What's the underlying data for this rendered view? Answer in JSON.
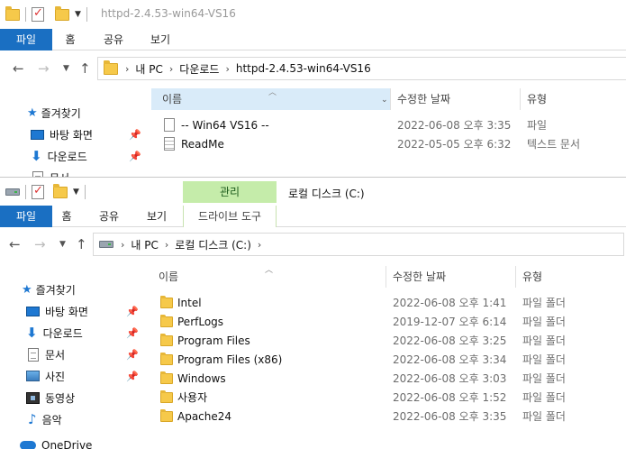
{
  "win1": {
    "title": "httpd-2.4.53-win64-VS16",
    "tabs": [
      "파일",
      "홈",
      "공유",
      "보기"
    ],
    "address": {
      "crumbs": [
        "내 PC",
        "다운로드",
        "httpd-2.4.53-win64-VS16"
      ]
    },
    "sidebar": {
      "items": [
        {
          "label": "즐겨찾기",
          "icon": "star-icon"
        },
        {
          "label": "바탕 화면",
          "icon": "desktop-icon",
          "pinned": true
        },
        {
          "label": "다운로드",
          "icon": "download-arrow-icon",
          "pinned": true
        },
        {
          "label": "문서",
          "icon": "document-icon",
          "pinned": true
        }
      ]
    },
    "columns": {
      "name": "이름",
      "date": "수정한 날짜",
      "type": "유형"
    },
    "files": [
      {
        "name": "-- Win64 VS16  --",
        "date": "2022-06-08 오후 3:35",
        "type": "파일",
        "icon": "blank-file-icon"
      },
      {
        "name": "ReadMe",
        "date": "2022-05-05 오후 6:32",
        "type": "텍스트 문서",
        "icon": "text-file-icon"
      }
    ]
  },
  "win2": {
    "tabs": [
      "파일",
      "홈",
      "공유",
      "보기"
    ],
    "context_tab_header": "관리",
    "context_tab": "드라이브 도구",
    "context_title": "로컬 디스크 (C:)",
    "address": {
      "crumbs": [
        "내 PC",
        "로컬 디스크 (C:)"
      ]
    },
    "sidebar": {
      "items": [
        {
          "label": "즐겨찾기",
          "icon": "star-icon"
        },
        {
          "label": "바탕 화면",
          "icon": "desktop-icon",
          "pinned": true
        },
        {
          "label": "다운로드",
          "icon": "download-arrow-icon",
          "pinned": true
        },
        {
          "label": "문서",
          "icon": "document-icon",
          "pinned": true
        },
        {
          "label": "사진",
          "icon": "pictures-icon",
          "pinned": true
        },
        {
          "label": "동영상",
          "icon": "video-icon"
        },
        {
          "label": "음악",
          "icon": "music-icon"
        },
        {
          "label": "OneDrive",
          "icon": "onedrive-cloud-icon"
        }
      ]
    },
    "columns": {
      "name": "이름",
      "date": "수정한 날짜",
      "type": "유형"
    },
    "files": [
      {
        "name": "Intel",
        "date": "2022-06-08 오후 1:41",
        "type": "파일 폴더"
      },
      {
        "name": "PerfLogs",
        "date": "2019-12-07 오후 6:14",
        "type": "파일 폴더"
      },
      {
        "name": "Program Files",
        "date": "2022-06-08 오후 3:25",
        "type": "파일 폴더"
      },
      {
        "name": "Program Files (x86)",
        "date": "2022-06-08 오후 3:34",
        "type": "파일 폴더"
      },
      {
        "name": "Windows",
        "date": "2022-06-08 오후 3:03",
        "type": "파일 폴더"
      },
      {
        "name": "사용자",
        "date": "2022-06-08 오후 1:52",
        "type": "파일 폴더"
      },
      {
        "name": "Apache24",
        "date": "2022-06-08 오후 3:35",
        "type": "파일 폴더"
      }
    ]
  },
  "colors": {
    "file_tab": "#1a6fc2",
    "context_tab": "#c5ecaa",
    "selected_header": "#d9ebf9",
    "folder": "#f6c94a"
  }
}
